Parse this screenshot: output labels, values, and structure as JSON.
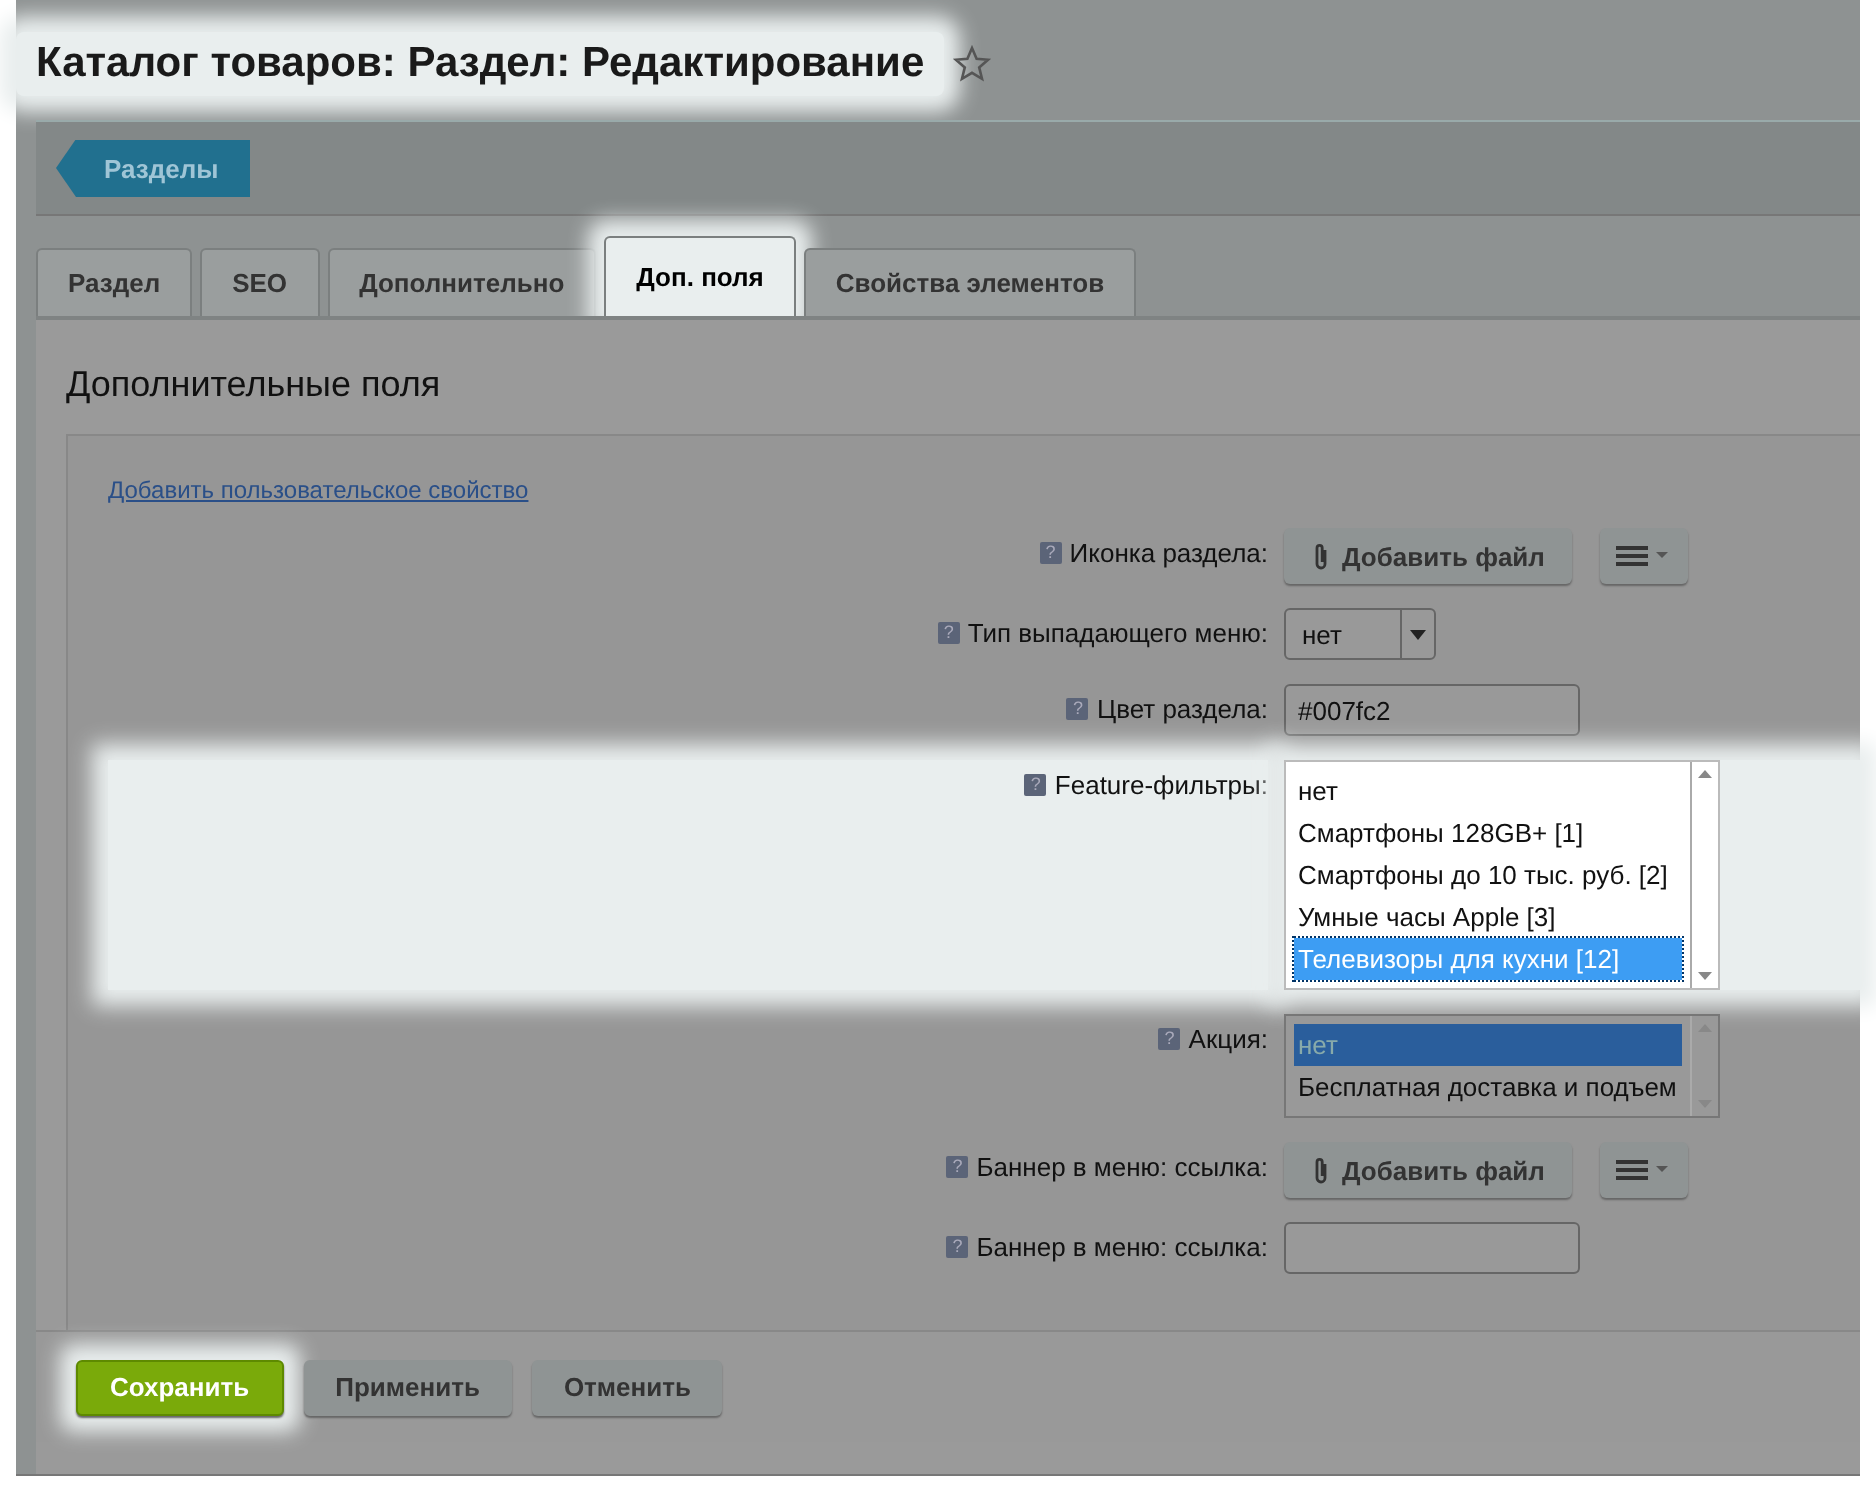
{
  "header": {
    "title": "Каталог товаров: Раздел: Редактирование",
    "highlighted": true
  },
  "toolbar": {
    "back_button": "Разделы"
  },
  "tabs": [
    {
      "label": "Раздел",
      "selected": false,
      "highlighted": false
    },
    {
      "label": "SEO",
      "selected": false,
      "highlighted": false
    },
    {
      "label": "Дополнительно",
      "selected": false,
      "highlighted": false
    },
    {
      "label": "Доп. поля",
      "selected": true,
      "highlighted": true
    },
    {
      "label": "Свойства элементов",
      "selected": false,
      "highlighted": false
    }
  ],
  "section": {
    "title": "Дополнительные поля",
    "add_link": "Добавить пользовательское свойство"
  },
  "fields": [
    {
      "kind": "file",
      "help": "?",
      "label": "Иконка раздела:",
      "button": "Добавить файл",
      "highlighted": false
    },
    {
      "kind": "select",
      "help": "?",
      "label": "Тип выпадающего меню:",
      "value": "нет",
      "highlighted": false
    },
    {
      "kind": "text",
      "help": "?",
      "label": "Цвет раздела:",
      "value": "#007fc2",
      "highlighted": false
    },
    {
      "kind": "listbox",
      "help": "?",
      "label": "Feature-фильтры:",
      "highlighted": true,
      "options": [
        {
          "text": "нет",
          "selected": false
        },
        {
          "text": "Смартфоны 128GB+ [1]",
          "selected": false
        },
        {
          "text": "Смартфоны до 10 тыс. руб. [2]",
          "selected": false
        },
        {
          "text": "Умные часы Apple [3]",
          "selected": false
        },
        {
          "text": "Телевизоры для кухни [12]",
          "selected": true
        }
      ]
    },
    {
      "kind": "listbox",
      "help": "?",
      "label": "Акция:",
      "highlighted": false,
      "options": [
        {
          "text": "нет",
          "selected": true
        },
        {
          "text": "Бесплатная доставка и подъем",
          "selected": false
        }
      ]
    },
    {
      "kind": "file",
      "help": "?",
      "label": "Баннер в меню: ссылка:",
      "button": "Добавить файл",
      "highlighted": false
    },
    {
      "kind": "text",
      "help": "?",
      "label": "Баннер в меню: ссылка:",
      "highlighted": false
    }
  ],
  "buttons": [
    {
      "label": "Сохранить",
      "kind": "primary",
      "highlighted": true
    },
    {
      "label": "Применить",
      "kind": "normal",
      "highlighted": false
    },
    {
      "label": "Отменить",
      "kind": "normal",
      "highlighted": false
    }
  ]
}
